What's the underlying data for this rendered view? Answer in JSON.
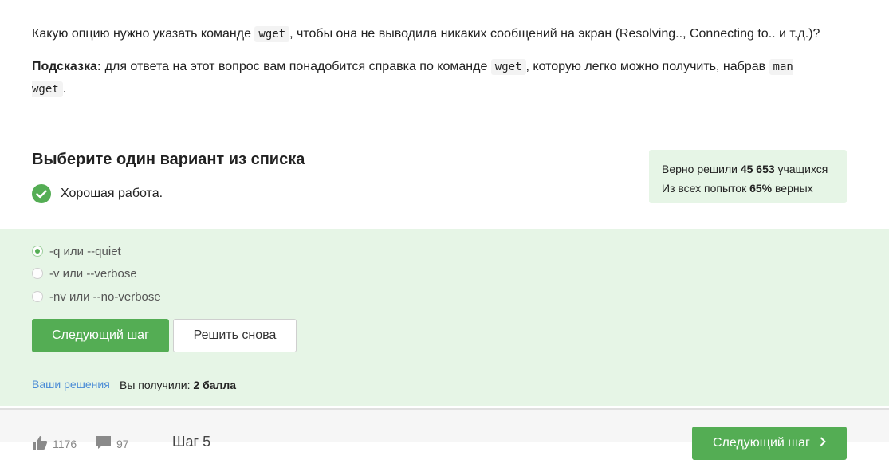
{
  "question": {
    "text_before": "Какую опцию нужно указать команде ",
    "code": "wget",
    "text_after": ", чтобы она не выводила никаких сообщений на экран (Resolving.., Connecting to.. и т.д.)?"
  },
  "hint": {
    "label": "Подсказка:",
    "text_1": " для ответа на этот вопрос вам понадобится справка по команде ",
    "code_1": "wget",
    "text_2": ", которую легко можно получить, набрав ",
    "code_2": "man wget",
    "text_3": "."
  },
  "task_heading": "Выберите один вариант из списка",
  "feedback": "Хорошая работа.",
  "stats": {
    "line1_prefix": "Верно решили ",
    "line1_value": "45 653",
    "line1_suffix": " учащихся",
    "line2_prefix": "Из всех попыток ",
    "line2_value": "65%",
    "line2_suffix": " верных"
  },
  "options": [
    {
      "label": "-q или --quiet",
      "checked": true
    },
    {
      "label": "-v или --verbose",
      "checked": false
    },
    {
      "label": "-nv или --no-verbose",
      "checked": false
    }
  ],
  "buttons": {
    "next_step": "Следующий шаг",
    "solve_again": "Решить снова"
  },
  "solutions_link": "Ваши решения",
  "score": {
    "prefix": "Вы получили: ",
    "value": "2 балла"
  },
  "footer": {
    "likes": "1176",
    "comments": "97",
    "step": "Шаг 5",
    "next_step": "Следующий шаг"
  },
  "colors": {
    "accent": "#54ad54",
    "success_background": "#e6f5e6",
    "link": "#4a8bd6"
  }
}
